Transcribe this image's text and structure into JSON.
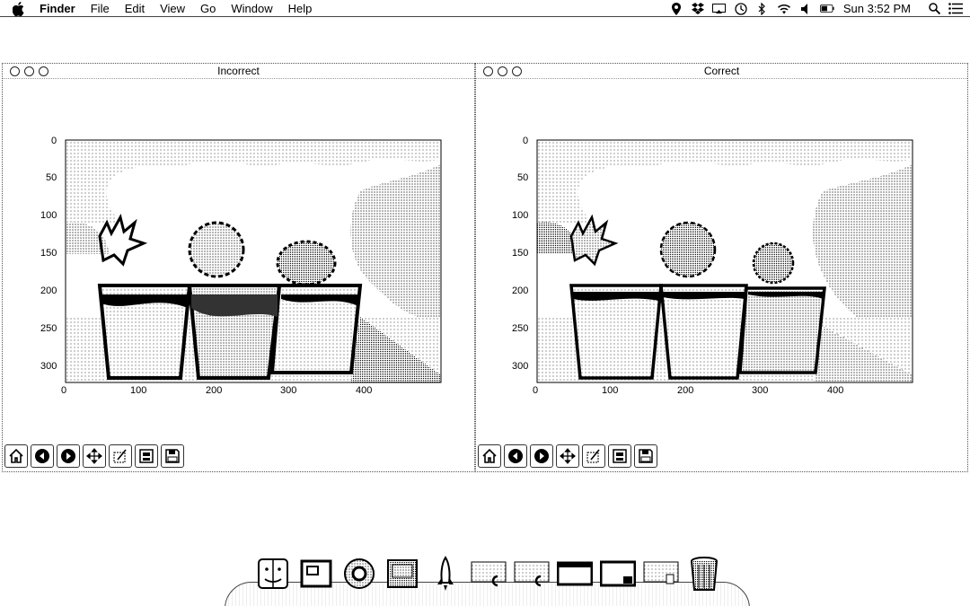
{
  "menubar": {
    "app_name": "Finder",
    "menus": [
      "File",
      "Edit",
      "View",
      "Go",
      "Window",
      "Help"
    ],
    "clock": "Sun 3:52 PM"
  },
  "windows": [
    {
      "title": "Incorrect",
      "x_ticks": [
        "0",
        "100",
        "200",
        "300",
        "400"
      ],
      "y_ticks": [
        "0",
        "50",
        "100",
        "150",
        "200",
        "250",
        "300"
      ]
    },
    {
      "title": "Correct",
      "x_ticks": [
        "0",
        "100",
        "200",
        "300",
        "400"
      ],
      "y_ticks": [
        "0",
        "50",
        "100",
        "150",
        "200",
        "250",
        "300"
      ]
    }
  ],
  "toolbar_icons": [
    "home-icon",
    "back-icon",
    "forward-icon",
    "pan-icon",
    "zoom-icon",
    "subplots-icon",
    "save-icon"
  ],
  "dock_icons": [
    "finder-icon",
    "window-icon",
    "chrome-icon",
    "preview-icon",
    "rocket-icon",
    "doc-icon",
    "doc-icon",
    "window-icon",
    "window-icon",
    "doc-icon",
    "trash-icon"
  ]
}
